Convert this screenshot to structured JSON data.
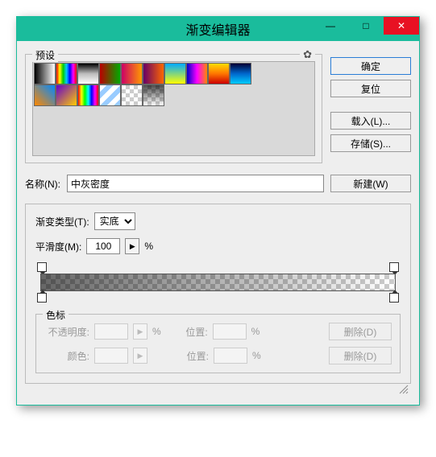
{
  "window": {
    "title": "渐变编辑器",
    "minimize_glyph": "—",
    "maximize_glyph": "□",
    "close_glyph": "✕"
  },
  "presets": {
    "legend": "预设",
    "gear_glyph": "✿"
  },
  "buttons": {
    "ok": "确定",
    "reset": "复位",
    "load": "载入(L)...",
    "save": "存储(S)..."
  },
  "name": {
    "label": "名称(N):",
    "value": "中灰密度",
    "new_button": "新建(W)"
  },
  "gradient": {
    "type_label": "渐变类型(T):",
    "type_value": "实底",
    "smooth_label": "平滑度(M):",
    "smooth_value": "100",
    "percent": "%",
    "arrow": "▶"
  },
  "colorstop": {
    "legend": "色标",
    "opacity_label": "不透明度:",
    "color_label": "颜色:",
    "position_label": "位置:",
    "percent": "%",
    "delete": "删除(D)",
    "arrow": "▶"
  }
}
